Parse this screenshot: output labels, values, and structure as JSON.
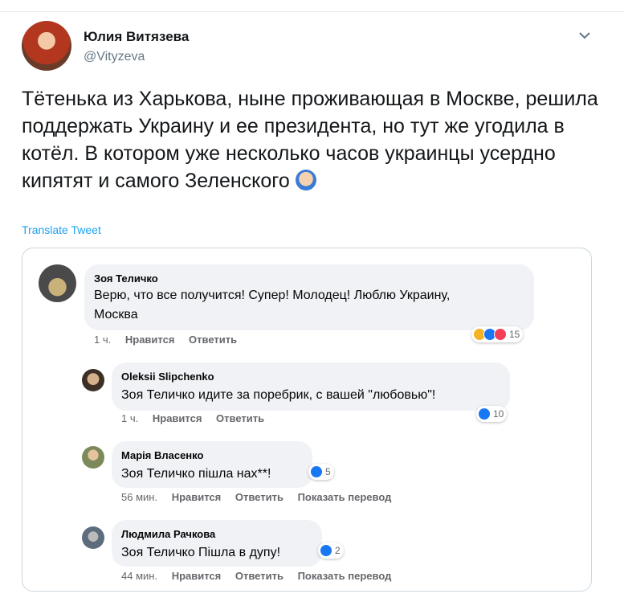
{
  "tweet": {
    "author_name": "Юлия Витязева",
    "author_handle": "@Vityzeva",
    "text": "Тётенька из Харькова, ныне проживающая в Москве, решила поддержать Украину и ее президента, но тут же угодила в котёл. В котором уже несколько часов украинцы усердно кипятят и самого Зеленского",
    "text_emoji": "facepalm-emoji",
    "translate_label": "Translate Tweet",
    "accent_color": "#1da1f2"
  },
  "comments": [
    {
      "name": "Зоя Теличко",
      "text_line1": "Верю, что все получится! Супер! Молодец! Люблю Украину,",
      "text_line2": "Москва",
      "time": "1 ч.",
      "like": "Нравится",
      "reply": "Ответить",
      "reaction_count": "15"
    },
    {
      "name": "Oleksii Slipchenko",
      "text_line1": "Зоя Теличко идите за поребрик, с вашей \"любовью\"!",
      "time": "1 ч.",
      "like": "Нравится",
      "reply": "Ответить",
      "reaction_count": "10"
    },
    {
      "name": "Марія Власенко",
      "text_line1": "Зоя Теличко пішла нах**!",
      "time": "56 мин.",
      "like": "Нравится",
      "reply": "Ответить",
      "translate": "Показать перевод",
      "reaction_count": "5"
    },
    {
      "name": "Людмила Рачкова",
      "text_line1": "Зоя Теличко Пішла в дупу!",
      "time": "44 мин.",
      "like": "Нравится",
      "reply": "Ответить",
      "translate": "Показать перевод",
      "reaction_count": "2"
    }
  ]
}
